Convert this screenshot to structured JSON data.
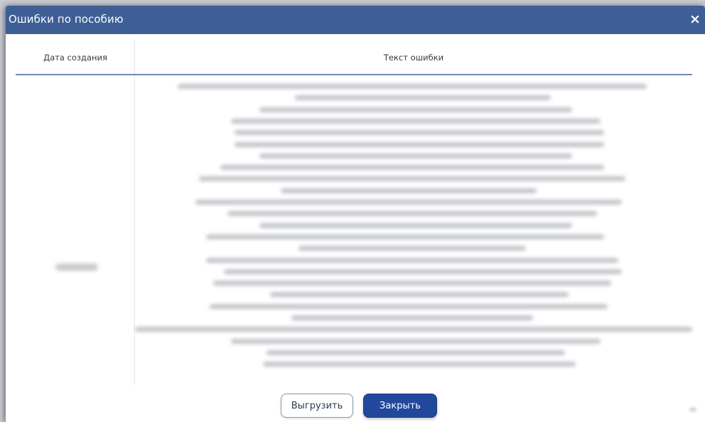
{
  "dialog": {
    "title": "Ошибки по пособию",
    "close_glyph": "×"
  },
  "table": {
    "columns": [
      "Дата создания",
      "Текст ошибки"
    ],
    "rows": [
      {
        "date": "",
        "text": ""
      }
    ]
  },
  "buttons": {
    "export_label": "Выгрузить",
    "close_label": "Закрыть"
  },
  "colors": {
    "header_bg": "#3e5f95",
    "primary_button": "#22489b",
    "header_underline": "#6d8ab3"
  }
}
